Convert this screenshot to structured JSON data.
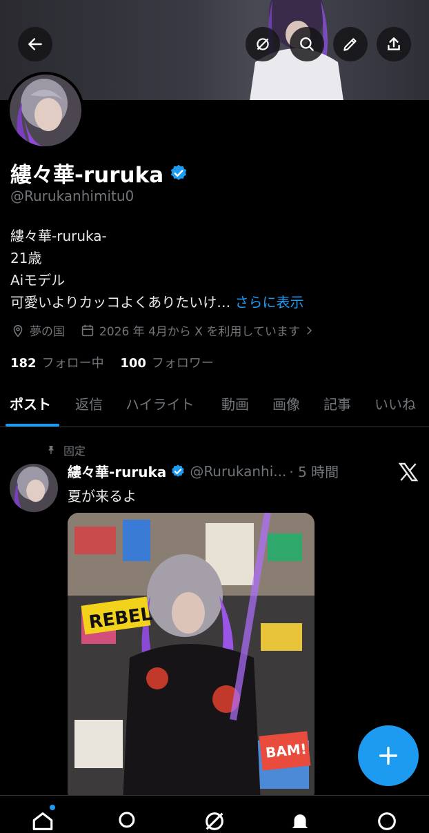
{
  "header": {
    "back_icon": "arrow-left-icon",
    "actions": [
      "grok-icon",
      "search-icon",
      "edit-icon",
      "share-icon"
    ]
  },
  "profile": {
    "name": "縷々華-ruruka",
    "handle": "@Rurukanhimitu0",
    "bio_lines": [
      "縷々華-ruruka-",
      "21歳",
      "Aiモデル",
      "可愛いよりカッコよくありたいけ…"
    ],
    "bio_more": "さらに表示",
    "location": "夢の国",
    "joined": "2026 年 4月から X を利用しています",
    "following_count": "182",
    "following_label": "フォロー中",
    "followers_count": "100",
    "followers_label": "フォロワー"
  },
  "tabs": [
    "ポスト",
    "返信",
    "ハイライト",
    "動画",
    "画像",
    "記事",
    "いいね"
  ],
  "post": {
    "pinned_label": "固定",
    "author_name": "縷々華-ruruka",
    "author_handle": "@Rurukanhi...",
    "time": "· 5 時間",
    "text": "夏が来るよ",
    "image_labels": [
      "REBEL",
      "BAM!"
    ]
  },
  "colors": {
    "accent": "#1d9bf0",
    "background": "#000000",
    "muted": "#71767b",
    "text": "#e7e9ea"
  }
}
